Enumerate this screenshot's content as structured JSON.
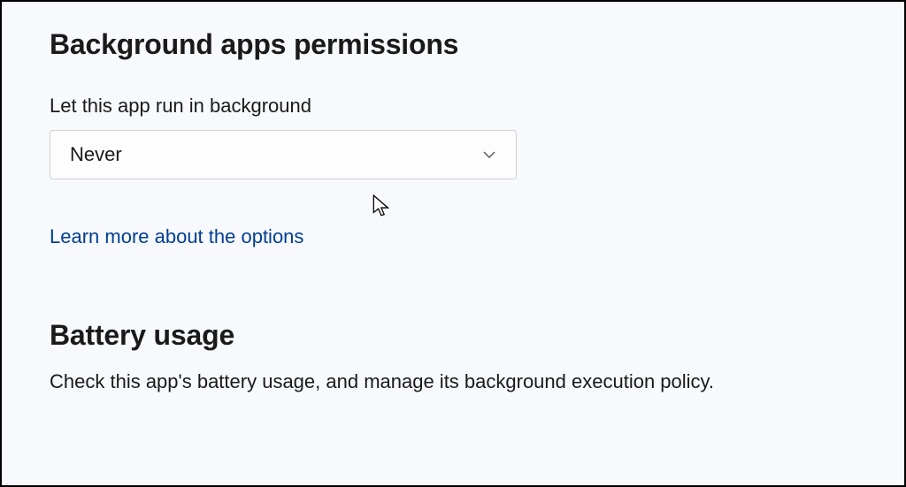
{
  "background_apps": {
    "heading": "Background apps permissions",
    "field_label": "Let this app run in background",
    "dropdown_value": "Never",
    "learn_more": "Learn more about the options"
  },
  "battery_usage": {
    "heading": "Battery usage",
    "description": "Check this app's battery usage, and manage its background execution policy."
  }
}
